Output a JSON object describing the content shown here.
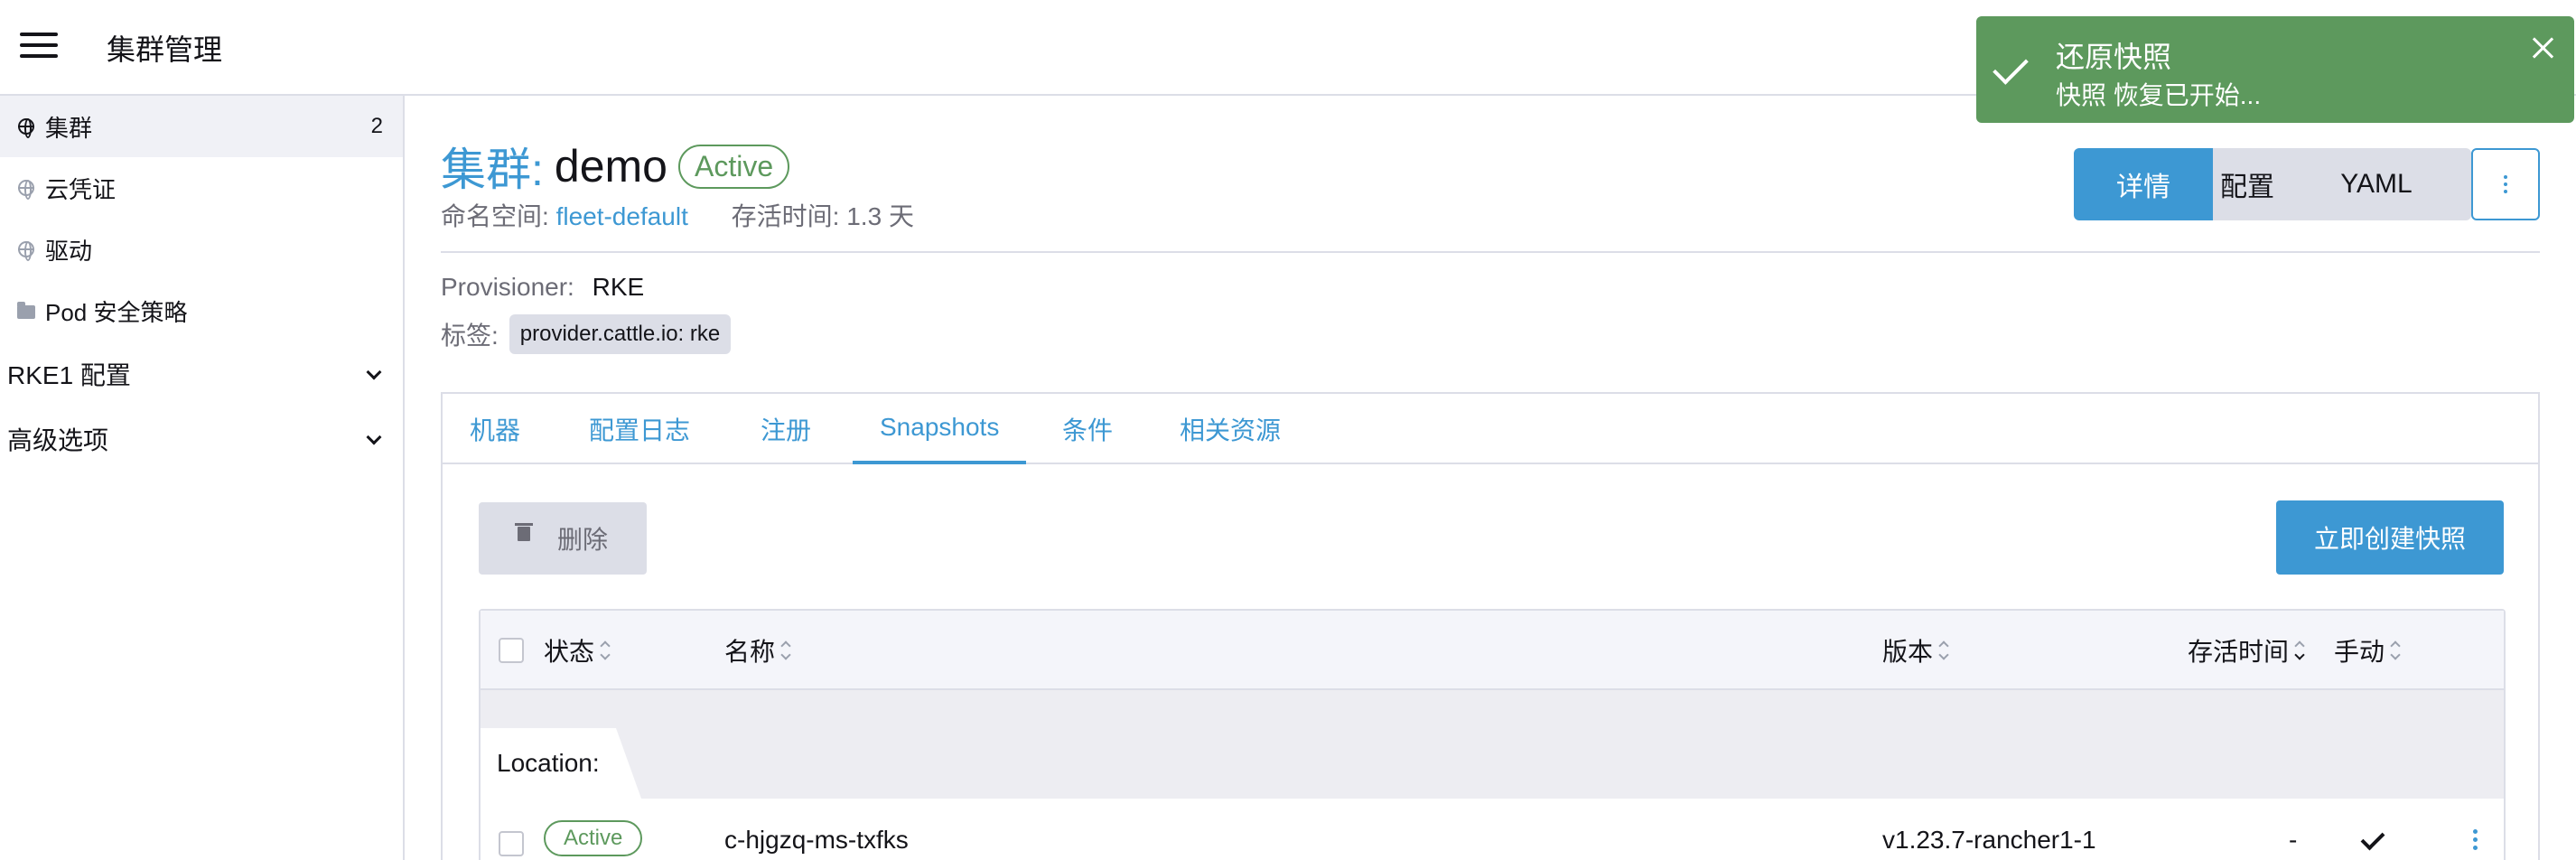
{
  "header": {
    "title": "集群管理"
  },
  "sidebar": {
    "items": [
      {
        "label": "集群",
        "count": "2"
      },
      {
        "label": "云凭证"
      },
      {
        "label": "驱动"
      },
      {
        "label": "Pod 安全策略"
      }
    ],
    "groups": [
      {
        "label": "RKE1 配置"
      },
      {
        "label": "高级选项"
      }
    ]
  },
  "cluster": {
    "type_label": "集群:",
    "name": "demo",
    "state": "Active",
    "namespace_label": "命名空间:",
    "namespace": "fleet-default",
    "age_label": "存活时间:",
    "age": "1.3 天",
    "provisioner_label": "Provisioner:",
    "provisioner": "RKE",
    "labels_label": "标签:",
    "label_tag": "provider.cattle.io: rke"
  },
  "view_buttons": [
    "详情",
    "配置",
    "YAML"
  ],
  "tabs": [
    "机器",
    "配置日志",
    "注册",
    "Snapshots",
    "条件",
    "相关资源"
  ],
  "actions": {
    "delete": "删除",
    "create_snapshot": "立即创建快照"
  },
  "table": {
    "headers": {
      "state": "状态",
      "name": "名称",
      "version": "版本",
      "age": "存活时间",
      "manual": "手动"
    },
    "group_label": "Location:",
    "rows": [
      {
        "state": "Active",
        "name": "c-hjgzq-ms-txfks",
        "version": "v1.23.7-rancher1-1",
        "age": "-"
      }
    ]
  },
  "toast": {
    "title": "还原快照",
    "message": "快照 恢复已开始..."
  },
  "colors": {
    "primary": "#3d98d3",
    "success": "#5d995d",
    "border": "#dcdee7"
  }
}
